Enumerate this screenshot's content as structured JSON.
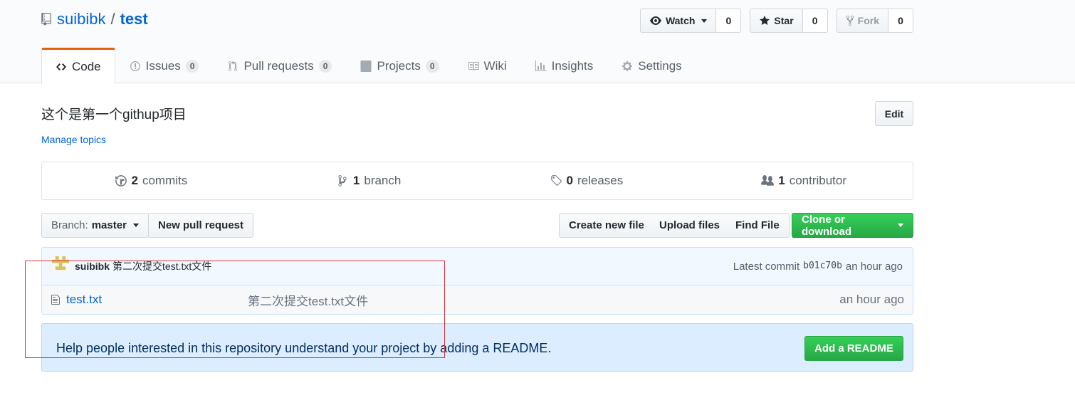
{
  "header": {
    "owner": "suibibk",
    "separator": "/",
    "repo": "test",
    "watch": {
      "label": "Watch",
      "count": "0"
    },
    "star": {
      "label": "Star",
      "count": "0"
    },
    "fork": {
      "label": "Fork",
      "count": "0"
    }
  },
  "tabs": [
    {
      "label": "Code",
      "icon": "code-icon"
    },
    {
      "label": "Issues",
      "count": "0",
      "icon": "issue-icon"
    },
    {
      "label": "Pull requests",
      "count": "0",
      "icon": "pull-request-icon"
    },
    {
      "label": "Projects",
      "count": "0",
      "icon": "project-icon"
    },
    {
      "label": "Wiki",
      "icon": "book-icon"
    },
    {
      "label": "Insights",
      "icon": "graph-icon"
    },
    {
      "label": "Settings",
      "icon": "gear-icon"
    }
  ],
  "repo": {
    "description": "这个是第一个githup项目",
    "edit_label": "Edit",
    "manage_topics": "Manage topics"
  },
  "summary": {
    "commits": {
      "num": "2",
      "label": "commits"
    },
    "branches": {
      "num": "1",
      "label": "branch"
    },
    "releases": {
      "num": "0",
      "label": "releases"
    },
    "contributors": {
      "num": "1",
      "label": "contributor"
    }
  },
  "filenav": {
    "branch_prefix": "Branch:",
    "branch": "master",
    "new_pr": "New pull request",
    "create_file": "Create new file",
    "upload_files": "Upload files",
    "find_file": "Find File",
    "clone": "Clone or download"
  },
  "commit": {
    "author": "suibibk",
    "message": "第二次提交test.txt文件",
    "latest_label": "Latest commit",
    "sha": "b01c70b",
    "age": "an hour ago"
  },
  "files": [
    {
      "name": "test.txt",
      "message": "第二次提交test.txt文件",
      "age": "an hour ago"
    }
  ],
  "readme": {
    "prompt": "Help people interested in this repository understand your project by adding a README.",
    "button": "Add a README"
  },
  "colors": {
    "link": "#0366d6",
    "green": "#28a745",
    "tab_accent": "#e36209",
    "highlight_box": "#d9363e"
  }
}
